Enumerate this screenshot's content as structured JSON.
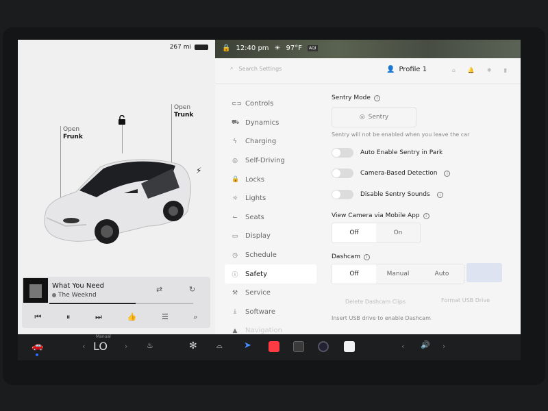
{
  "car": {
    "range": "267 mi",
    "frunk_label_1": "Open",
    "frunk_label_2": "Frunk",
    "trunk_label_1": "Open",
    "trunk_label_2": "Trunk"
  },
  "media": {
    "title": "What You Need",
    "artist": "The Weeknd",
    "progress": 0.6
  },
  "status": {
    "time": "12:40 pm",
    "temperature": "97°F",
    "aqi": "AQI"
  },
  "topbar": {
    "search_placeholder": "Search Settings",
    "profile": "Profile 1"
  },
  "menu": {
    "items": [
      {
        "label": "Controls",
        "icon": "toggle-icon"
      },
      {
        "label": "Dynamics",
        "icon": "car-icon"
      },
      {
        "label": "Charging",
        "icon": "bolt-icon"
      },
      {
        "label": "Self-Driving",
        "icon": "steering-wheel-icon"
      },
      {
        "label": "Locks",
        "icon": "lock-icon"
      },
      {
        "label": "Lights",
        "icon": "light-icon"
      },
      {
        "label": "Seats",
        "icon": "seat-icon"
      },
      {
        "label": "Display",
        "icon": "display-icon"
      },
      {
        "label": "Schedule",
        "icon": "clock-icon"
      },
      {
        "label": "Safety",
        "icon": "alert-icon"
      },
      {
        "label": "Service",
        "icon": "wrench-icon"
      },
      {
        "label": "Software",
        "icon": "download-icon"
      },
      {
        "label": "Navigation",
        "icon": "navigation-icon"
      }
    ]
  },
  "safety": {
    "sentry_mode_title": "Sentry Mode",
    "sentry_button": "Sentry",
    "sentry_note": "Sentry will not be enabled when you leave the car",
    "auto_enable": "Auto Enable Sentry in Park",
    "camera_detection": "Camera-Based Detection",
    "disable_sounds": "Disable Sentry Sounds",
    "view_camera_title": "View Camera via Mobile App",
    "view_camera_off": "Off",
    "view_camera_on": "On",
    "dashcam_title": "Dashcam",
    "dashcam_off": "Off",
    "dashcam_manual": "Manual",
    "dashcam_auto": "Auto",
    "delete_clips": "Delete Dashcam Clips",
    "format_usb": "Format USB Drive",
    "usb_note": "Insert USB drive to enable Dashcam"
  },
  "taskbar": {
    "gear_mode": "Manual",
    "fan_level": "LO"
  }
}
